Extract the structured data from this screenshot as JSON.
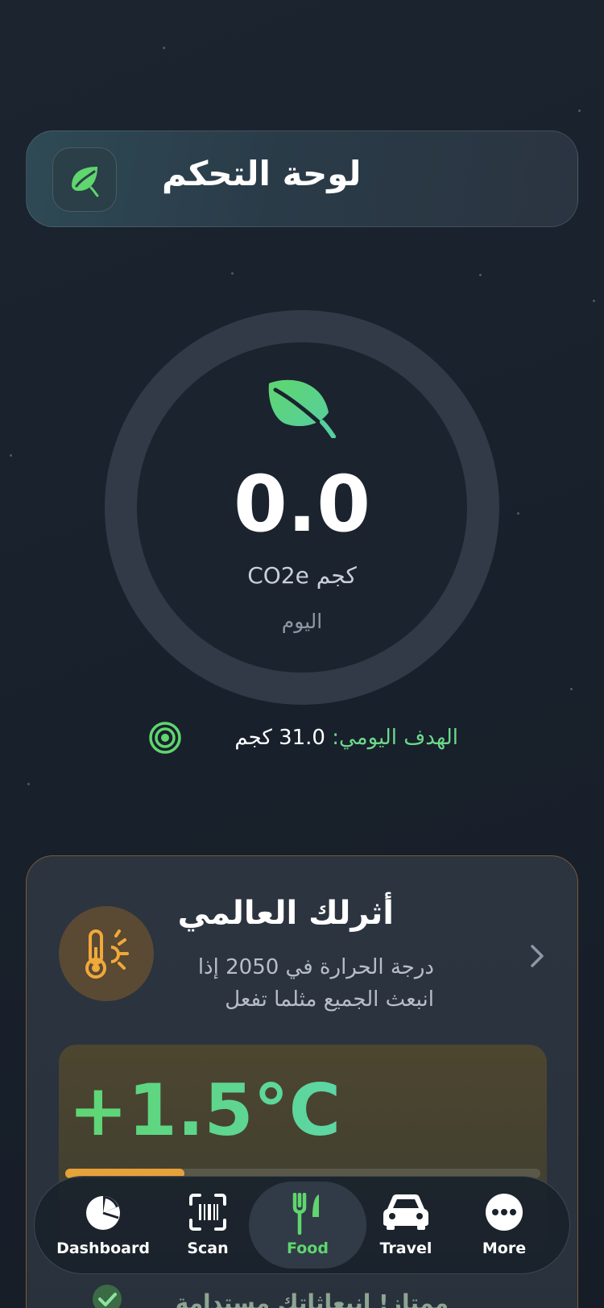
{
  "header": {
    "title": "لوحة التحكم",
    "icon": "leaf-icon"
  },
  "daily_emissions": {
    "value": "0.0",
    "unit": "كجم CO2e",
    "period": "اليوم",
    "icon": "leaf-icon"
  },
  "daily_goal": {
    "label": "الهدف اليومي:",
    "value": "31.0 كجم",
    "icon": "target-icon"
  },
  "impact_card": {
    "title": "أثرلك العالمي",
    "subtitle": "درجة الحرارة في 2050 إذا انبعث الجميع مثلما تفعل",
    "icon": "thermometer-sun-icon",
    "temperature": "+1.5°C",
    "temperature_progress": 0.25,
    "footer": "ممتاز! انبعاثاتك مستدامة"
  },
  "nav": {
    "items": [
      {
        "label": "Dashboard",
        "icon": "pie-chart-icon"
      },
      {
        "label": "Scan",
        "icon": "barcode-scan-icon"
      },
      {
        "label": "Food",
        "icon": "fork-knife-icon",
        "active": true
      },
      {
        "label": "Travel",
        "icon": "car-icon"
      },
      {
        "label": "More",
        "icon": "more-icon"
      }
    ]
  },
  "colors": {
    "accent_green": "#5fd66e",
    "warning_orange": "#e5a13a",
    "background": "#1b232e"
  }
}
